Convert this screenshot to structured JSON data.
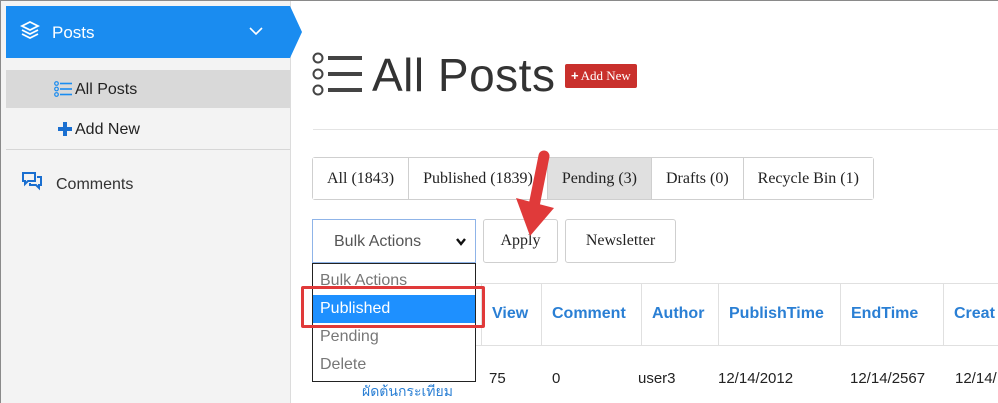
{
  "sidebar": {
    "header_label": "Posts",
    "items": [
      {
        "label": "All Posts",
        "icon": "list-icon",
        "active": true
      },
      {
        "label": "Add New",
        "icon": "plus-icon",
        "active": false
      }
    ],
    "comments_label": "Comments",
    "accent_color": "#1a8cf0"
  },
  "main": {
    "title": "All Posts",
    "add_new_label": "Add New",
    "tabs": [
      {
        "label": "All (1843)"
      },
      {
        "label": "Published (1839)"
      },
      {
        "label": "Pending (3)",
        "active": true
      },
      {
        "label": "Drafts (0)"
      },
      {
        "label": "Recycle Bin (1)"
      }
    ],
    "bulk_actions": {
      "selected": "Bulk Actions",
      "options": [
        "Bulk Actions",
        "Published",
        "Pending",
        "Delete"
      ],
      "highlighted": "Published"
    },
    "apply_label": "Apply",
    "newsletter_label": "Newsletter",
    "table": {
      "columns": [
        "View",
        "Comment",
        "Author",
        "PublishTime",
        "EndTime",
        "Creat"
      ],
      "row": {
        "title": "ผัดต้นกระเทียม",
        "view": "75",
        "comment": "0",
        "author": "user3",
        "publish_time": "12/14/2012",
        "end_time": "12/14/2567",
        "create_time": "12/14/"
      }
    }
  },
  "colors": {
    "highlight": "#1e90ff",
    "annotation_red": "#e03a3a",
    "link_blue": "#2a7fd4",
    "danger": "#c9302c"
  }
}
